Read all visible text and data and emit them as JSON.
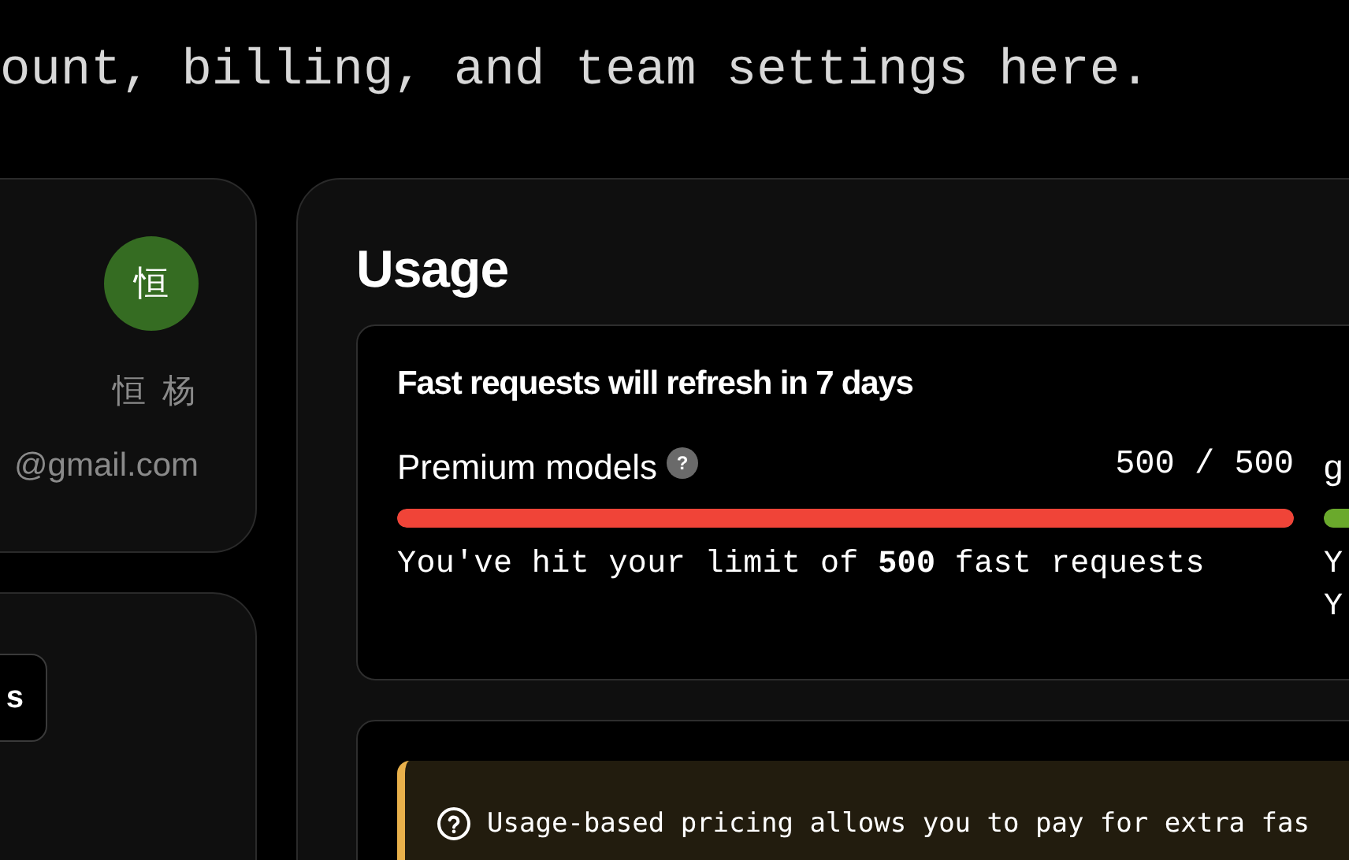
{
  "header": {
    "subtitle": "ount, billing, and team settings here."
  },
  "profile": {
    "avatar_initial": "恒",
    "name": "恒 杨",
    "email": "@gmail.com"
  },
  "side_card": {
    "button": "s"
  },
  "usage": {
    "title": "Usage",
    "refresh_note": "Fast requests will refresh in 7 days",
    "meters": [
      {
        "label": "Premium models",
        "help": "?",
        "count": "500 / 500",
        "level": 1,
        "color": "#f04438",
        "lines": [
          "You've hit your limit of **500** fast requests"
        ]
      },
      {
        "label": "g",
        "color": "#6aa92c",
        "lines": [
          "Y",
          "Y"
        ]
      }
    ],
    "info_banner": "Usage-based pricing allows you to pay for extra fas"
  }
}
